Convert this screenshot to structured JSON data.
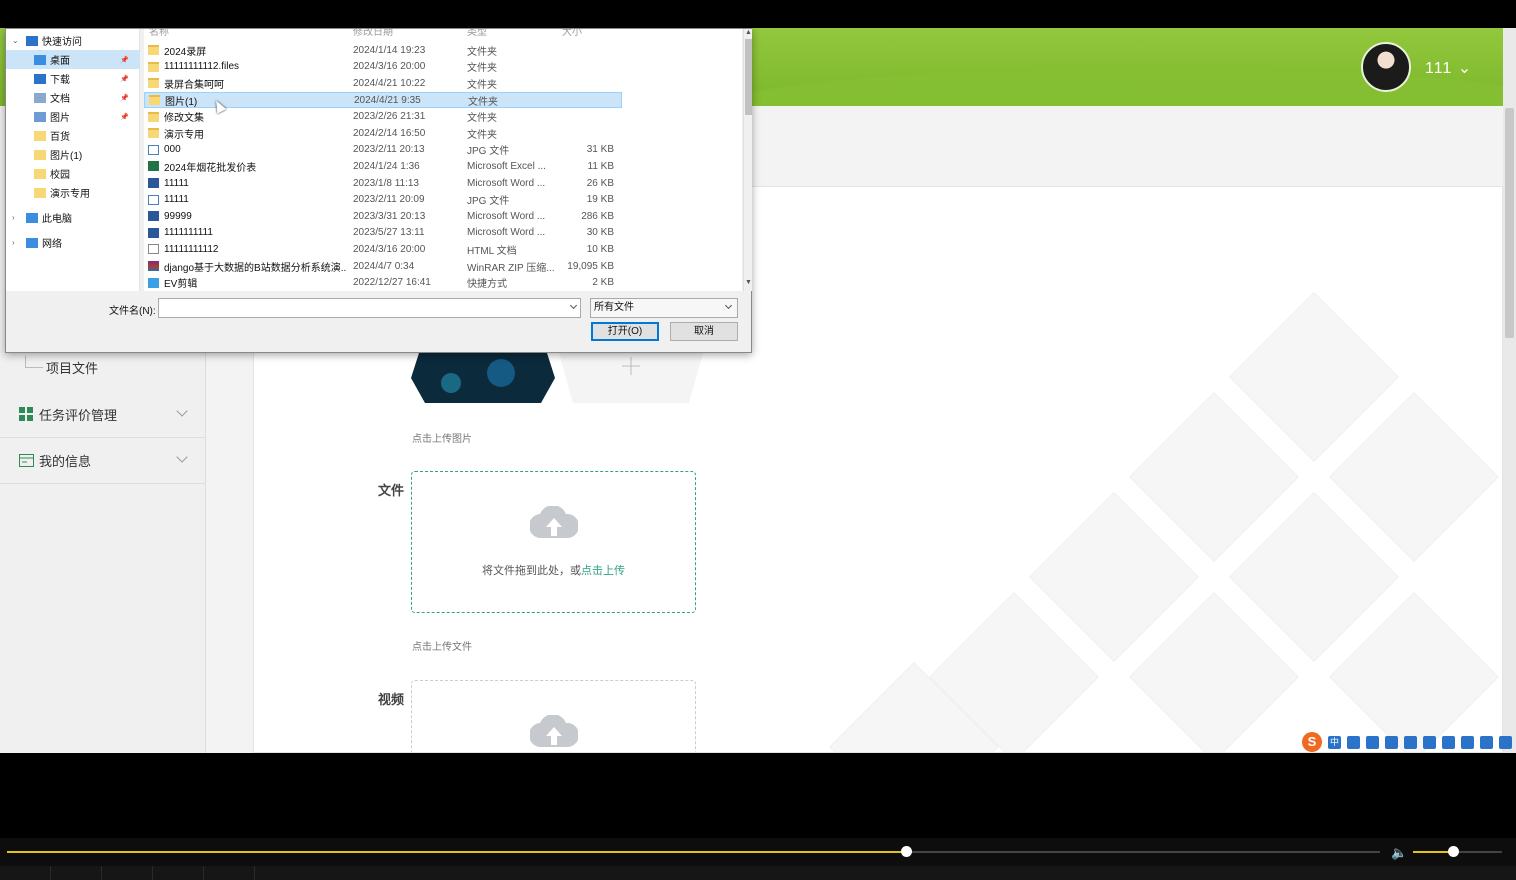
{
  "header": {
    "username": "111 ⌄"
  },
  "sidebar": {
    "sub_item": "项目文件",
    "menus": [
      {
        "label": "任务评价管理",
        "icon": "grid-icon"
      },
      {
        "label": "我的信息",
        "icon": "id-card-icon"
      }
    ]
  },
  "form": {
    "image_hint": "点击上传图片",
    "file_label": "文件",
    "drop_text": "将文件拖到此处，或",
    "drop_link": "点击上传",
    "file_hint": "点击上传文件",
    "video_label": "视频"
  },
  "tray": {
    "ime_label": "中",
    "logo": "S"
  },
  "dialog": {
    "headers": [
      "名称",
      "修改日期",
      "类型",
      "大小"
    ],
    "nav": [
      {
        "label": "快速访问",
        "icon": "star-icon",
        "expand": "expanded",
        "pinned": false,
        "selected": false
      },
      {
        "label": "桌面",
        "icon": "desktop-icon",
        "pinned": true,
        "selected": true
      },
      {
        "label": "下载",
        "icon": "download-icon",
        "pinned": true,
        "selected": false
      },
      {
        "label": "文档",
        "icon": "document-icon",
        "pinned": true,
        "selected": false
      },
      {
        "label": "图片",
        "icon": "picture-icon",
        "pinned": true,
        "selected": false
      },
      {
        "label": "百货",
        "icon": "folder-icon",
        "pinned": false,
        "selected": false
      },
      {
        "label": "图片(1)",
        "icon": "folder-icon",
        "pinned": false,
        "selected": false
      },
      {
        "label": "校园",
        "icon": "folder-icon",
        "pinned": false,
        "selected": false
      },
      {
        "label": "演示专用",
        "icon": "folder-icon",
        "pinned": false,
        "selected": false
      },
      {
        "label": "此电脑",
        "icon": "computer-icon",
        "expand": "collapsed",
        "pinned": false,
        "selected": false
      },
      {
        "label": "网络",
        "icon": "network-icon",
        "expand": "collapsed",
        "pinned": false,
        "selected": false
      }
    ],
    "files": [
      {
        "name": "2024录屏",
        "date": "2024/1/14 19:23",
        "type": "文件夹",
        "size": "",
        "icon": "folder"
      },
      {
        "name": "11111111112.files",
        "date": "2024/3/16 20:00",
        "type": "文件夹",
        "size": "",
        "icon": "folder"
      },
      {
        "name": "录屏合集呵呵",
        "date": "2024/4/21 10:22",
        "type": "文件夹",
        "size": "",
        "icon": "folder"
      },
      {
        "name": "图片(1)",
        "date": "2024/4/21 9:35",
        "type": "文件夹",
        "size": "",
        "icon": "folder",
        "selected": true
      },
      {
        "name": "修改文集",
        "date": "2023/2/26 21:31",
        "type": "文件夹",
        "size": "",
        "icon": "folder"
      },
      {
        "name": "演示专用",
        "date": "2024/2/14 16:50",
        "type": "文件夹",
        "size": "",
        "icon": "folder"
      },
      {
        "name": "000",
        "date": "2023/2/11 20:13",
        "type": "JPG 文件",
        "size": "31 KB",
        "icon": "img"
      },
      {
        "name": "2024年烟花批发价表",
        "date": "2024/1/24 1:36",
        "type": "Microsoft Excel ...",
        "size": "11 KB",
        "icon": "excel"
      },
      {
        "name": "11111",
        "date": "2023/1/8 11:13",
        "type": "Microsoft Word ...",
        "size": "26 KB",
        "icon": "word"
      },
      {
        "name": "11111",
        "date": "2023/2/11 20:09",
        "type": "JPG 文件",
        "size": "19 KB",
        "icon": "img"
      },
      {
        "name": "99999",
        "date": "2023/3/31 20:13",
        "type": "Microsoft Word ...",
        "size": "286 KB",
        "icon": "word"
      },
      {
        "name": "1111111111",
        "date": "2023/5/27 13:11",
        "type": "Microsoft Word ...",
        "size": "30 KB",
        "icon": "word"
      },
      {
        "name": "11111111112",
        "date": "2024/3/16 20:00",
        "type": "HTML 文档",
        "size": "10 KB",
        "icon": "html"
      },
      {
        "name": "django基于大数据的B站数据分析系统演...",
        "date": "2024/4/7 0:34",
        "type": "WinRAR ZIP 压缩...",
        "size": "19,095 KB",
        "icon": "rar"
      },
      {
        "name": "EV剪辑",
        "date": "2022/12/27 16:41",
        "type": "快捷方式",
        "size": "2 KB",
        "icon": "lnkf"
      }
    ],
    "filename_label": "文件名(N):",
    "filename_value": "",
    "filetype": "所有文件",
    "open_button": "打开(O)",
    "cancel_button": "取消"
  },
  "player": {
    "progress": 0.655,
    "volume": 0.45
  }
}
